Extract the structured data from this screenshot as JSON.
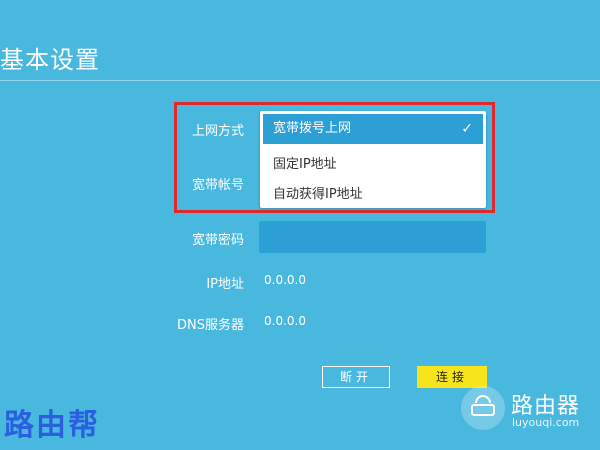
{
  "page": {
    "title": "基本设置"
  },
  "form": {
    "connection_type_label": "上网方式",
    "account_label": "宽带帐号",
    "password_label": "宽带密码",
    "ip_label": "IP地址",
    "ip_value": "0.0.0.0",
    "dns_label": "DNS服务器",
    "dns_value": "0.0.0.0"
  },
  "dropdown": {
    "selected": "宽带拨号上网",
    "check_icon": "check-icon",
    "options": [
      "固定IP地址",
      "自动获得IP地址"
    ]
  },
  "buttons": {
    "disconnect": "断开",
    "connect": "连接"
  },
  "watermark": {
    "left_text": "路由帮",
    "brand": "路由器",
    "url": "luyouqi.com"
  },
  "colors": {
    "background": "#49b8df",
    "field": "#2c9fd5",
    "highlight": "#e0282f",
    "connect_button": "#f6e51a"
  }
}
